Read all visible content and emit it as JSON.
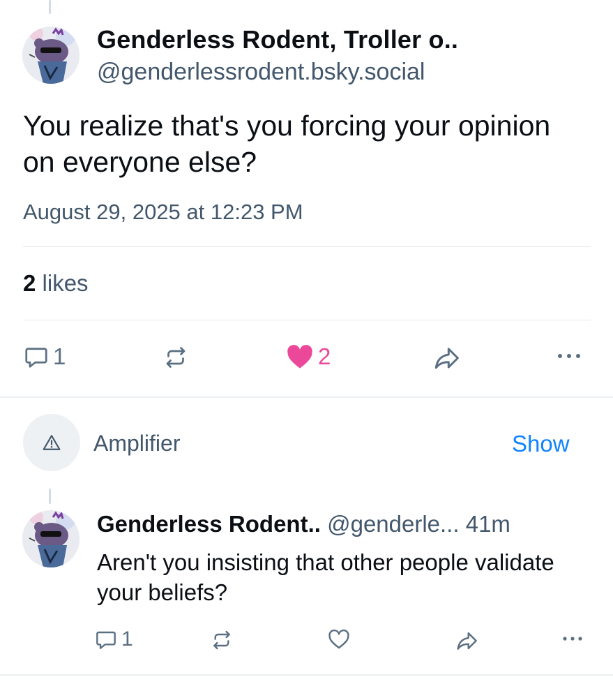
{
  "main_post": {
    "author_name": "Genderless Rodent, Troller o..",
    "author_handle": "@genderlessrodent.bsky.social",
    "text": "You realize that's you forcing your opinion on everyone else?",
    "timestamp": "August 29, 2025 at 12:23 PM",
    "likes_count": "2",
    "likes_word": "likes",
    "actions": {
      "reply_count": "1",
      "like_count": "2",
      "liked": true
    }
  },
  "content_warning": {
    "icon": "warning-triangle-icon",
    "label": "Amplifier",
    "show_label": "Show"
  },
  "reply_post": {
    "author_name": "Genderless Rodent..",
    "author_handle": "@genderle...",
    "time_ago": "41m",
    "text": "Aren't you insisting that other people validate your beliefs?",
    "actions": {
      "reply_count": "1",
      "liked": false
    }
  },
  "colors": {
    "like_pink": "#ec4899",
    "link_blue": "#1083fe",
    "muted_text": "#42576c",
    "icon_gray": "#5b6f82"
  }
}
